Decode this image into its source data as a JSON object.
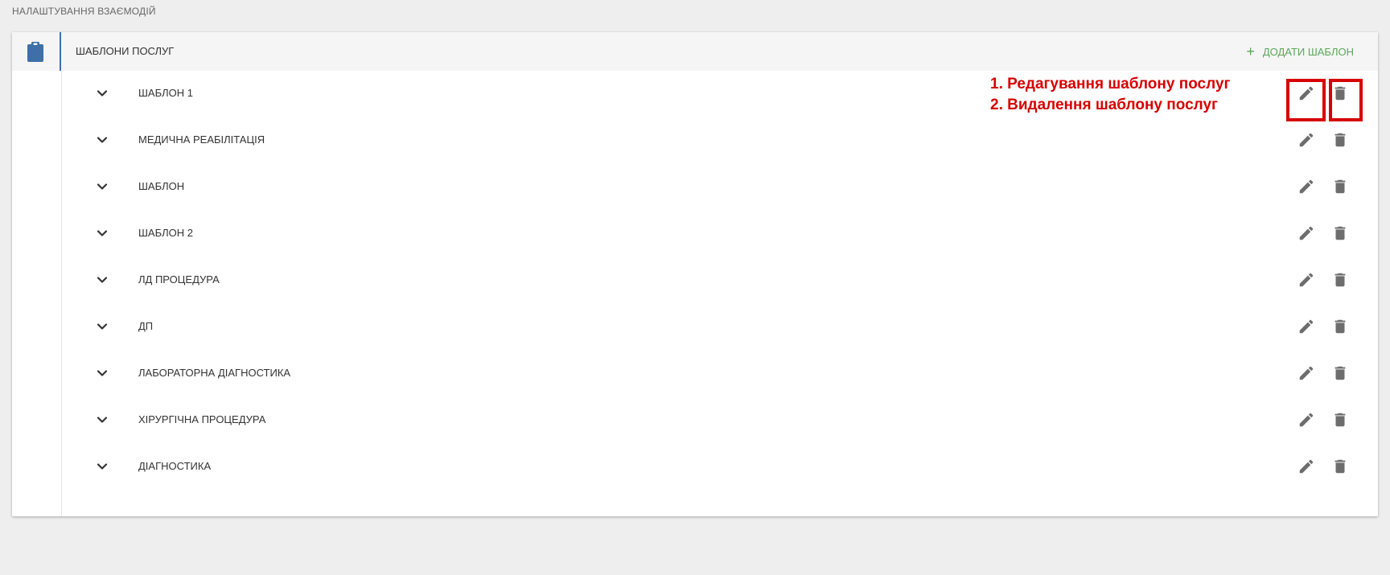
{
  "page": {
    "section_title": "НАЛАШТУВАННЯ ВЗАЄМОДІЙ"
  },
  "card": {
    "title": "ШАБЛОНИ ПОСЛУГ",
    "add_button_label": "ДОДАТИ ШАБЛОН",
    "add_button_icon": "+",
    "header_icon": "clipboard-icon"
  },
  "templates": [
    {
      "name": "ШАБЛОН 1"
    },
    {
      "name": "МЕДИЧНА РЕАБІЛІТАЦІЯ"
    },
    {
      "name": "ШАБЛОН"
    },
    {
      "name": "ШАБЛОН 2"
    },
    {
      "name": "ЛД ПРОЦЕДУРА"
    },
    {
      "name": "ДП"
    },
    {
      "name": "ЛАБОРАТОРНА ДІАГНОСТИКА"
    },
    {
      "name": "ХІРУРГІЧНА ПРОЦЕДУРА"
    },
    {
      "name": "ДІАГНОСТИКА"
    }
  ],
  "annotation": {
    "line1": "1. Редагування шаблону послуг",
    "line2": "2. Видалення шаблону послуг"
  },
  "colors": {
    "accent_blue": "#3f6fa8",
    "add_green": "#5aa857",
    "annotation_red": "#d60000",
    "icon_gray": "#6d6d6d"
  }
}
